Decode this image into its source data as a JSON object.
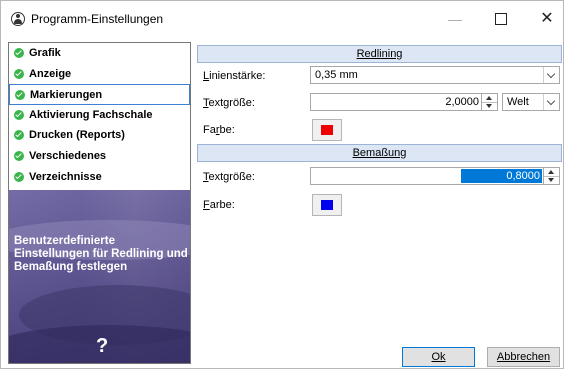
{
  "window": {
    "title": "Programm-Einstellungen",
    "icon": "app-globe-icon",
    "minimize": "—",
    "close": "✕"
  },
  "nav": {
    "items": [
      {
        "label": "Grafik"
      },
      {
        "label": "Anzeige"
      },
      {
        "label": "Markierungen",
        "active": true
      },
      {
        "label": "Aktivierung Fachschale"
      },
      {
        "label": "Drucken (Reports)"
      },
      {
        "label": "Verschiedenes"
      },
      {
        "label": "Verzeichnisse"
      }
    ],
    "promo_text": "Benutzerdefinierte Einstellungen für Redlining und Bemaßung festlegen",
    "help": "?"
  },
  "redlining": {
    "header": "Redlining",
    "linienstaerke": {
      "label_pre": "L",
      "label_rest": "inienstärke:",
      "value": "0,35 mm"
    },
    "textgroesse": {
      "label_pre": "T",
      "label_rest": "extgröße:",
      "value": "2,0000",
      "unit": "Welt"
    },
    "farbe": {
      "label_pre": "Fa",
      "label_u": "r",
      "label_rest": "be:",
      "color": "#ee0000"
    }
  },
  "bemassung": {
    "header": "Bemaßung",
    "textgroesse": {
      "label_u": "T",
      "label_rest": "extgröße:",
      "value": "0,8000"
    },
    "farbe": {
      "label_u": "F",
      "label_rest": "arbe:",
      "color": "#0000ee"
    }
  },
  "buttons": {
    "ok": "Ok",
    "cancel": "Abbrechen"
  },
  "colors": {
    "section_bg": "#dce6f4",
    "selection": "#0078d7",
    "check": "#39b54a"
  }
}
